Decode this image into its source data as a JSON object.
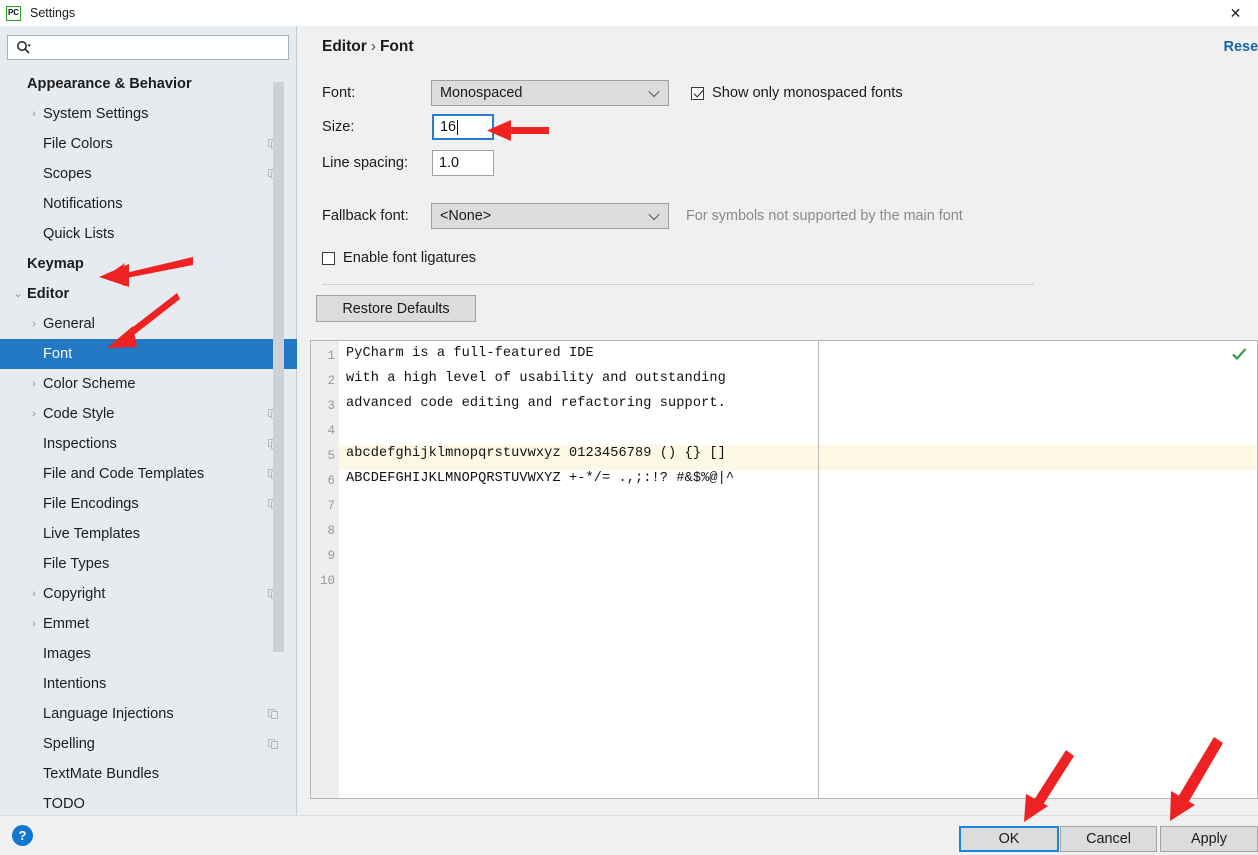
{
  "window": {
    "title": "Settings",
    "app_icon_text": "PC",
    "close_icon": "close-icon"
  },
  "sidebar": {
    "search": {
      "value": "",
      "placeholder": ""
    },
    "items": [
      {
        "label": "Appearance & Behavior",
        "indent": 0,
        "bold": true,
        "twisty": "",
        "badge": false,
        "selected": false
      },
      {
        "label": "System Settings",
        "indent": 1,
        "bold": false,
        "twisty": "›",
        "badge": false,
        "selected": false
      },
      {
        "label": "File Colors",
        "indent": 1,
        "bold": false,
        "twisty": "",
        "badge": true,
        "selected": false
      },
      {
        "label": "Scopes",
        "indent": 1,
        "bold": false,
        "twisty": "",
        "badge": true,
        "selected": false
      },
      {
        "label": "Notifications",
        "indent": 1,
        "bold": false,
        "twisty": "",
        "badge": false,
        "selected": false
      },
      {
        "label": "Quick Lists",
        "indent": 1,
        "bold": false,
        "twisty": "",
        "badge": false,
        "selected": false
      },
      {
        "label": "Keymap",
        "indent": 0,
        "bold": true,
        "twisty": "",
        "badge": false,
        "selected": false
      },
      {
        "label": "Editor",
        "indent": 0,
        "bold": true,
        "twisty": "⌄",
        "badge": false,
        "selected": false
      },
      {
        "label": "General",
        "indent": 1,
        "bold": false,
        "twisty": "›",
        "badge": false,
        "selected": false
      },
      {
        "label": "Font",
        "indent": 1,
        "bold": false,
        "twisty": "",
        "badge": false,
        "selected": true
      },
      {
        "label": "Color Scheme",
        "indent": 1,
        "bold": false,
        "twisty": "›",
        "badge": false,
        "selected": false
      },
      {
        "label": "Code Style",
        "indent": 1,
        "bold": false,
        "twisty": "›",
        "badge": true,
        "selected": false
      },
      {
        "label": "Inspections",
        "indent": 1,
        "bold": false,
        "twisty": "",
        "badge": true,
        "selected": false
      },
      {
        "label": "File and Code Templates",
        "indent": 1,
        "bold": false,
        "twisty": "",
        "badge": true,
        "selected": false
      },
      {
        "label": "File Encodings",
        "indent": 1,
        "bold": false,
        "twisty": "",
        "badge": true,
        "selected": false
      },
      {
        "label": "Live Templates",
        "indent": 1,
        "bold": false,
        "twisty": "",
        "badge": false,
        "selected": false
      },
      {
        "label": "File Types",
        "indent": 1,
        "bold": false,
        "twisty": "",
        "badge": false,
        "selected": false
      },
      {
        "label": "Copyright",
        "indent": 1,
        "bold": false,
        "twisty": "›",
        "badge": true,
        "selected": false
      },
      {
        "label": "Emmet",
        "indent": 1,
        "bold": false,
        "twisty": "›",
        "badge": false,
        "selected": false
      },
      {
        "label": "Images",
        "indent": 1,
        "bold": false,
        "twisty": "",
        "badge": false,
        "selected": false
      },
      {
        "label": "Intentions",
        "indent": 1,
        "bold": false,
        "twisty": "",
        "badge": false,
        "selected": false
      },
      {
        "label": "Language Injections",
        "indent": 1,
        "bold": false,
        "twisty": "",
        "badge": true,
        "selected": false
      },
      {
        "label": "Spelling",
        "indent": 1,
        "bold": false,
        "twisty": "",
        "badge": true,
        "selected": false
      },
      {
        "label": "TextMate Bundles",
        "indent": 1,
        "bold": false,
        "twisty": "",
        "badge": false,
        "selected": false
      },
      {
        "label": "TODO",
        "indent": 1,
        "bold": false,
        "twisty": "",
        "badge": false,
        "selected": false
      }
    ]
  },
  "content": {
    "breadcrumb_root": "Editor",
    "breadcrumb_sep": "›",
    "breadcrumb_leaf": "Font",
    "reset_label": "Reset",
    "font_label": "Font:",
    "font_value": "Monospaced",
    "show_mono_label": "Show only monospaced fonts",
    "show_mono_checked": true,
    "size_label": "Size:",
    "size_value": "16",
    "line_spacing_label": "Line spacing:",
    "line_spacing_value": "1.0",
    "fallback_label": "Fallback font:",
    "fallback_value": "<None>",
    "fallback_hint": "For symbols not supported by the main font",
    "ligatures_label": "Enable font ligatures",
    "ligatures_checked": false,
    "restore_defaults_label": "Restore Defaults"
  },
  "preview": {
    "line_numbers": [
      "1",
      "2",
      "3",
      "4",
      "5",
      "6",
      "7",
      "8",
      "9",
      "10"
    ],
    "lines": [
      "PyCharm is a full-featured IDE",
      "with a high level of usability and outstanding",
      "advanced code editing and refactoring support.",
      "",
      "abcdefghijklmnopqrstuvwxyz 0123456789 () {} []",
      "ABCDEFGHIJKLMNOPQRSTUVWXYZ +-*/= .,;:!? #&$%@|^"
    ],
    "highlighted_line": "4",
    "status_icon": "checkmark-icon"
  },
  "footer": {
    "help_label": "?",
    "ok_label": "OK",
    "cancel_label": "Cancel",
    "apply_label": "Apply"
  },
  "colors": {
    "selection_blue": "#2378c4",
    "link_blue": "#1766ad",
    "focus_blue": "#1a85e0",
    "annotation_red": "#ee2222",
    "highlight_yellow": "#fdf8e3",
    "check_green": "#3a9b52"
  }
}
